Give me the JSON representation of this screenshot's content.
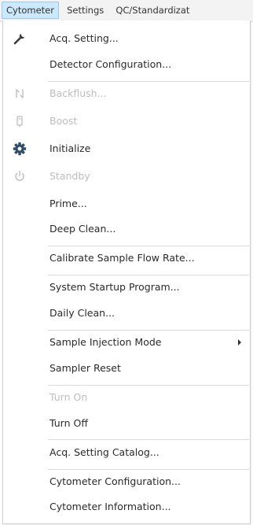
{
  "menubar": {
    "items": [
      {
        "label": "Cytometer"
      },
      {
        "label": "Settings"
      },
      {
        "label": "QC/Standardizat"
      }
    ]
  },
  "menu": {
    "items": [
      {
        "label": "Acq. Setting...",
        "icon": "wrench-icon",
        "enabled": true
      },
      {
        "label": "Detector Configuration...",
        "icon": "",
        "enabled": true
      },
      {
        "label": "Backflush...",
        "icon": "backflush-icon",
        "enabled": false
      },
      {
        "label": "Boost",
        "icon": "boost-icon",
        "enabled": false
      },
      {
        "label": "Initialize",
        "icon": "gear-icon",
        "enabled": true
      },
      {
        "label": "Standby",
        "icon": "power-icon",
        "enabled": false
      },
      {
        "label": "Prime...",
        "icon": "",
        "enabled": true
      },
      {
        "label": "Deep Clean...",
        "icon": "",
        "enabled": true
      },
      {
        "label": "Calibrate Sample Flow Rate...",
        "icon": "",
        "enabled": true
      },
      {
        "label": "System Startup Program...",
        "icon": "",
        "enabled": true
      },
      {
        "label": "Daily Clean...",
        "icon": "",
        "enabled": true
      },
      {
        "label": "Sample Injection Mode",
        "icon": "",
        "enabled": true,
        "submenu": true
      },
      {
        "label": "Sampler Reset",
        "icon": "",
        "enabled": true
      },
      {
        "label": "Turn On",
        "icon": "",
        "enabled": false
      },
      {
        "label": "Turn Off",
        "icon": "",
        "enabled": true
      },
      {
        "label": "Acq. Setting Catalog...",
        "icon": "",
        "enabled": true
      },
      {
        "label": "Cytometer Configuration...",
        "icon": "",
        "enabled": true
      },
      {
        "label": "Cytometer Information...",
        "icon": "",
        "enabled": true
      }
    ]
  },
  "colors": {
    "active_menu_bg": "#cce8fb",
    "active_menu_border": "#9cc9ea",
    "text": "#2a2a2a",
    "disabled_text": "#bdbdbd",
    "icon_dark": "#3b3b3b",
    "icon_disabled": "#bdbdbd"
  }
}
